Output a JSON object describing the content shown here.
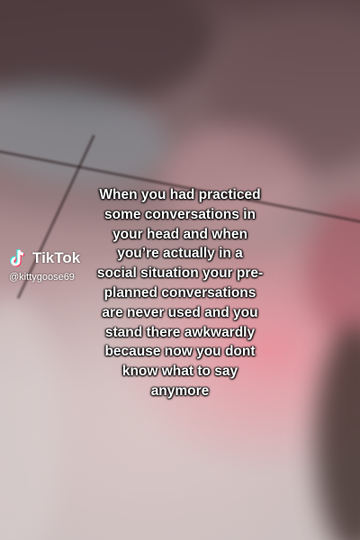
{
  "caption": {
    "lines": [
      "When you had practiced",
      "some conversations in",
      "your head and when",
      "you’re actually in a",
      "social situation your pre-",
      "planned conversations",
      "are never used and you",
      "stand there awkwardly",
      "because now you dont",
      "know what to say",
      "anymore"
    ]
  },
  "watermark": {
    "brand": "TikTok",
    "username": "@kittygoose69",
    "icon": "tiktok-logo-icon"
  },
  "colors": {
    "caption_text": "#ffffff",
    "tiktok_cyan": "#25f4ee",
    "tiktok_red": "#fe2c55"
  }
}
